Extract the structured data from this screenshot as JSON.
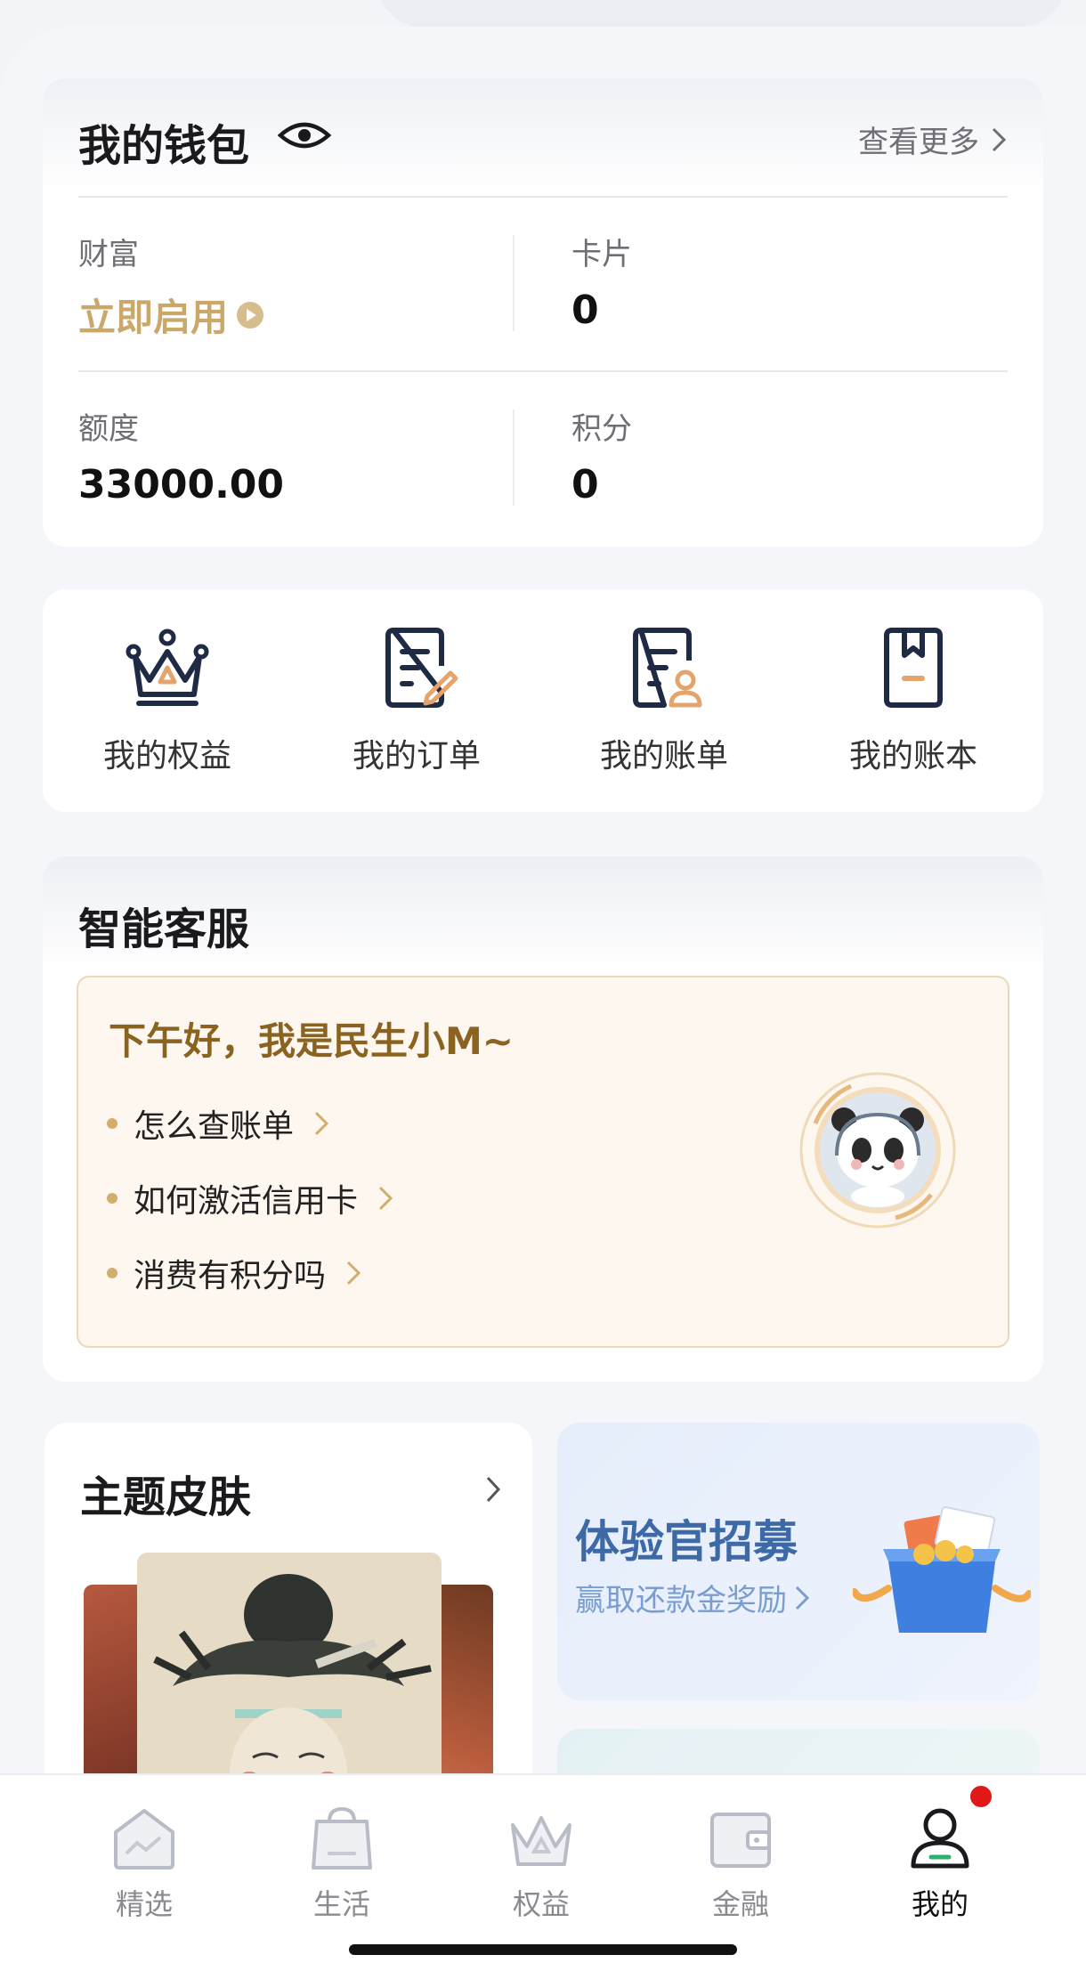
{
  "wallet": {
    "title": "我的钱包",
    "more": "查看更多",
    "wealth_label": "财富",
    "wealth_action": "立即启用",
    "cards_label": "卡片",
    "cards_value": "0",
    "limit_label": "额度",
    "limit_value": "33000.00",
    "points_label": "积分",
    "points_value": "0"
  },
  "shortcuts": [
    {
      "label": "我的权益",
      "icon": "crown-icon"
    },
    {
      "label": "我的订单",
      "icon": "order-doc-icon"
    },
    {
      "label": "我的账单",
      "icon": "bill-doc-icon"
    },
    {
      "label": "我的账本",
      "icon": "ledger-book-icon"
    }
  ],
  "service": {
    "title": "智能客服",
    "greeting": "下午好，我是民生小M~",
    "questions": [
      "怎么查账单",
      "如何激活信用卡",
      "消费有积分吗"
    ]
  },
  "theme": {
    "title": "主题皮肤"
  },
  "promo": {
    "title": "体验官招募",
    "subtitle": "赢取还款金奖励"
  },
  "tabs": [
    {
      "label": "精选",
      "icon": "home-icon",
      "active": false
    },
    {
      "label": "生活",
      "icon": "shopping-bag-icon",
      "active": false
    },
    {
      "label": "权益",
      "icon": "crown-icon",
      "active": false
    },
    {
      "label": "金融",
      "icon": "wallet-icon",
      "active": false
    },
    {
      "label": "我的",
      "icon": "user-icon",
      "active": true
    }
  ],
  "colors": {
    "gold": "#c9a86a",
    "greeting_brown": "#8a6320",
    "promo_blue": "#3d6aa6",
    "badge_red": "#e01818"
  }
}
